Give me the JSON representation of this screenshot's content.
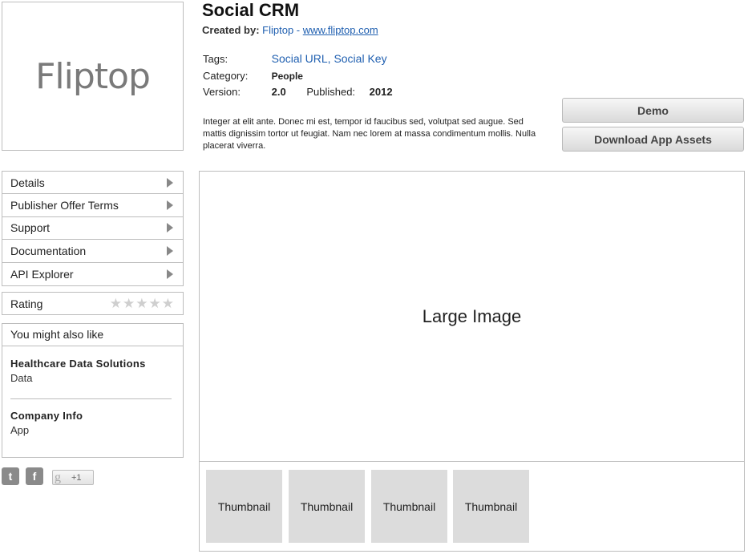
{
  "app": {
    "logo_text": "Fliptop",
    "title": "Social CRM",
    "created_label": "Created by:",
    "publisher": "Fliptop",
    "separator": " - ",
    "publisher_url": "www.fliptop.com"
  },
  "meta": {
    "tags_label": "Tags:",
    "tags": [
      "Social URL",
      "Social Key"
    ],
    "tag_separator": ", ",
    "category_label": "Category:",
    "category": "People",
    "version_label": "Version:",
    "version": "2.0",
    "published_label": "Published:",
    "published": "2012"
  },
  "description": "Integer at elit ante. Donec mi est, tempor id faucibus sed, volutpat sed augue. Sed mattis dignissim tortor ut feugiat. Nam nec lorem at massa condimentum mollis. Nulla placerat viverra.",
  "actions": {
    "demo": "Demo",
    "download": "Download App Assets"
  },
  "nav": {
    "items": [
      {
        "label": "Details"
      },
      {
        "label": "Publisher Offer Terms"
      },
      {
        "label": "Support"
      },
      {
        "label": "Documentation"
      },
      {
        "label": "API Explorer"
      }
    ]
  },
  "rating": {
    "label": "Rating",
    "stars_glyph": "★★★★★",
    "value": 0,
    "max": 5
  },
  "also_like": {
    "heading": "You might also like",
    "items": [
      {
        "title": "Healthcare Data Solutions",
        "subtitle": "Data"
      },
      {
        "title": "Company Info",
        "subtitle": "App"
      }
    ]
  },
  "social": {
    "twitter_glyph": "t",
    "facebook_glyph": "f",
    "gplus_glyph": "g",
    "gplus_label": "+1"
  },
  "preview": {
    "large_label": "Large Image",
    "thumbnails": [
      "Thumbnail",
      "Thumbnail",
      "Thumbnail",
      "Thumbnail"
    ]
  },
  "colors": {
    "link": "#1f5fb0",
    "border": "#bdbdbd",
    "thumb_bg": "#dcdcdc",
    "star_empty": "#cfcfcf"
  }
}
